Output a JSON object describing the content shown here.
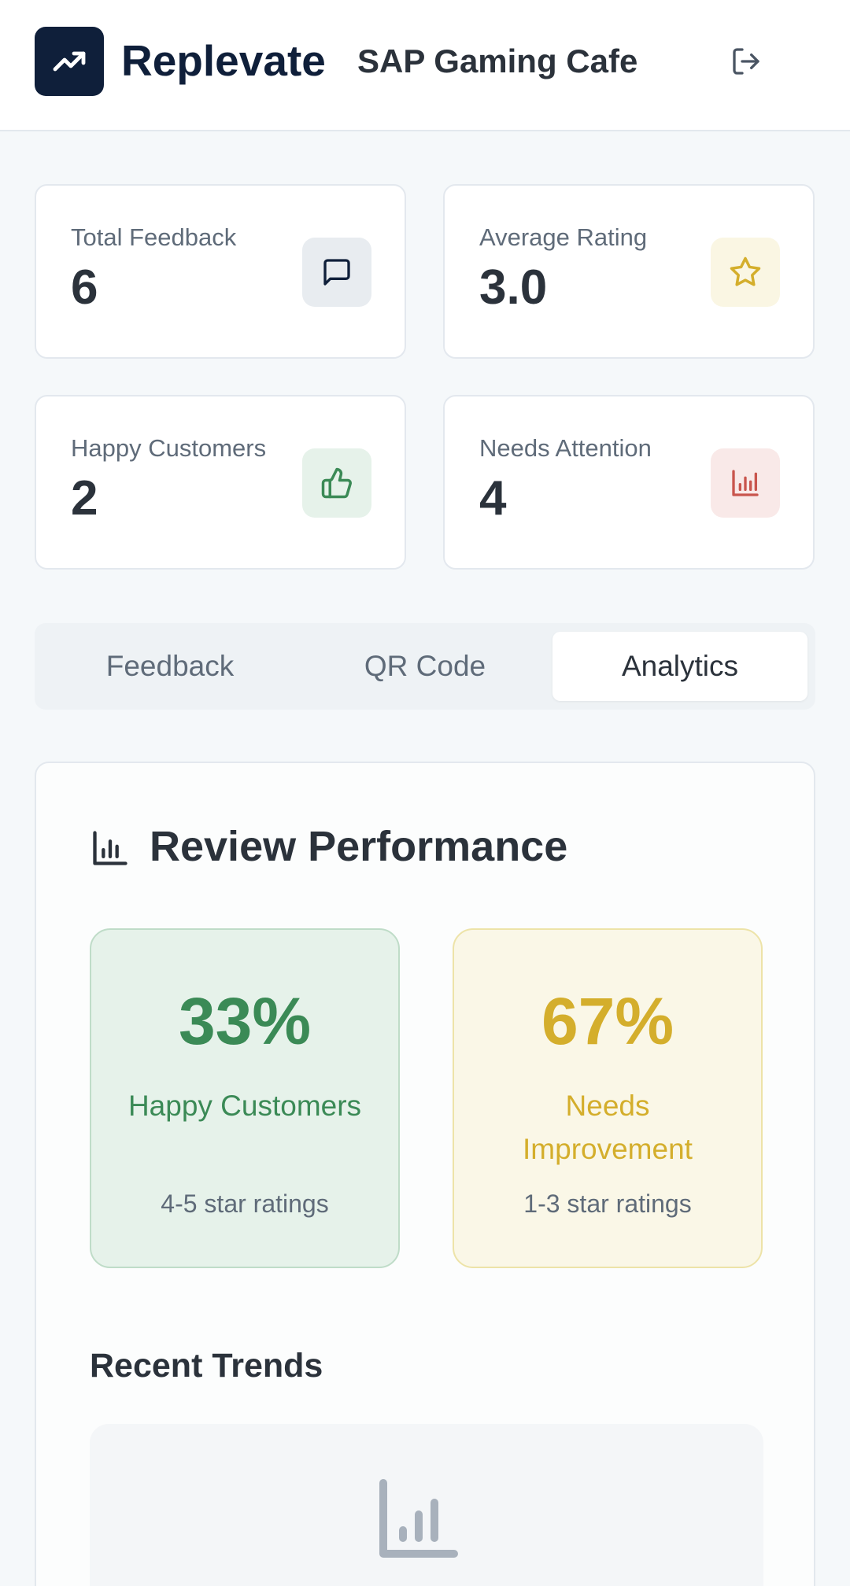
{
  "header": {
    "brand": "Replevate",
    "business_name": "SAP Gaming Cafe",
    "logo_icon": "trending-up-icon",
    "logout_icon": "logout-icon"
  },
  "stats": [
    {
      "label": "Total Feedback",
      "value": "6",
      "icon": "message-square-icon",
      "icon_color": "#0f1f3a",
      "icon_bg": "#e8ecf0"
    },
    {
      "label": "Average Rating",
      "value": "3.0",
      "icon": "star-icon",
      "icon_color": "#d4ae2c",
      "icon_bg": "#faf6e3"
    },
    {
      "label": "Happy Customers",
      "value": "2",
      "icon": "thumbs-up-icon",
      "icon_color": "#3b8a56",
      "icon_bg": "#e6f2ea"
    },
    {
      "label": "Needs Attention",
      "value": "4",
      "icon": "bar-chart-icon",
      "icon_color": "#c9554d",
      "icon_bg": "#f9e9e8"
    }
  ],
  "tabs": [
    {
      "label": "Feedback",
      "active": false
    },
    {
      "label": "QR Code",
      "active": false
    },
    {
      "label": "Analytics",
      "active": true
    }
  ],
  "review_performance": {
    "title": "Review Performance",
    "happy": {
      "percent": "33%",
      "label": "Happy Customers",
      "sub": "4-5 star ratings",
      "color": "#3b8a56"
    },
    "improvement": {
      "percent": "67%",
      "label": "Needs Improvement",
      "sub": "1-3 star ratings",
      "color": "#d4ae2c"
    }
  },
  "recent_trends": {
    "title": "Recent Trends",
    "placeholder_icon": "bar-chart-icon"
  }
}
